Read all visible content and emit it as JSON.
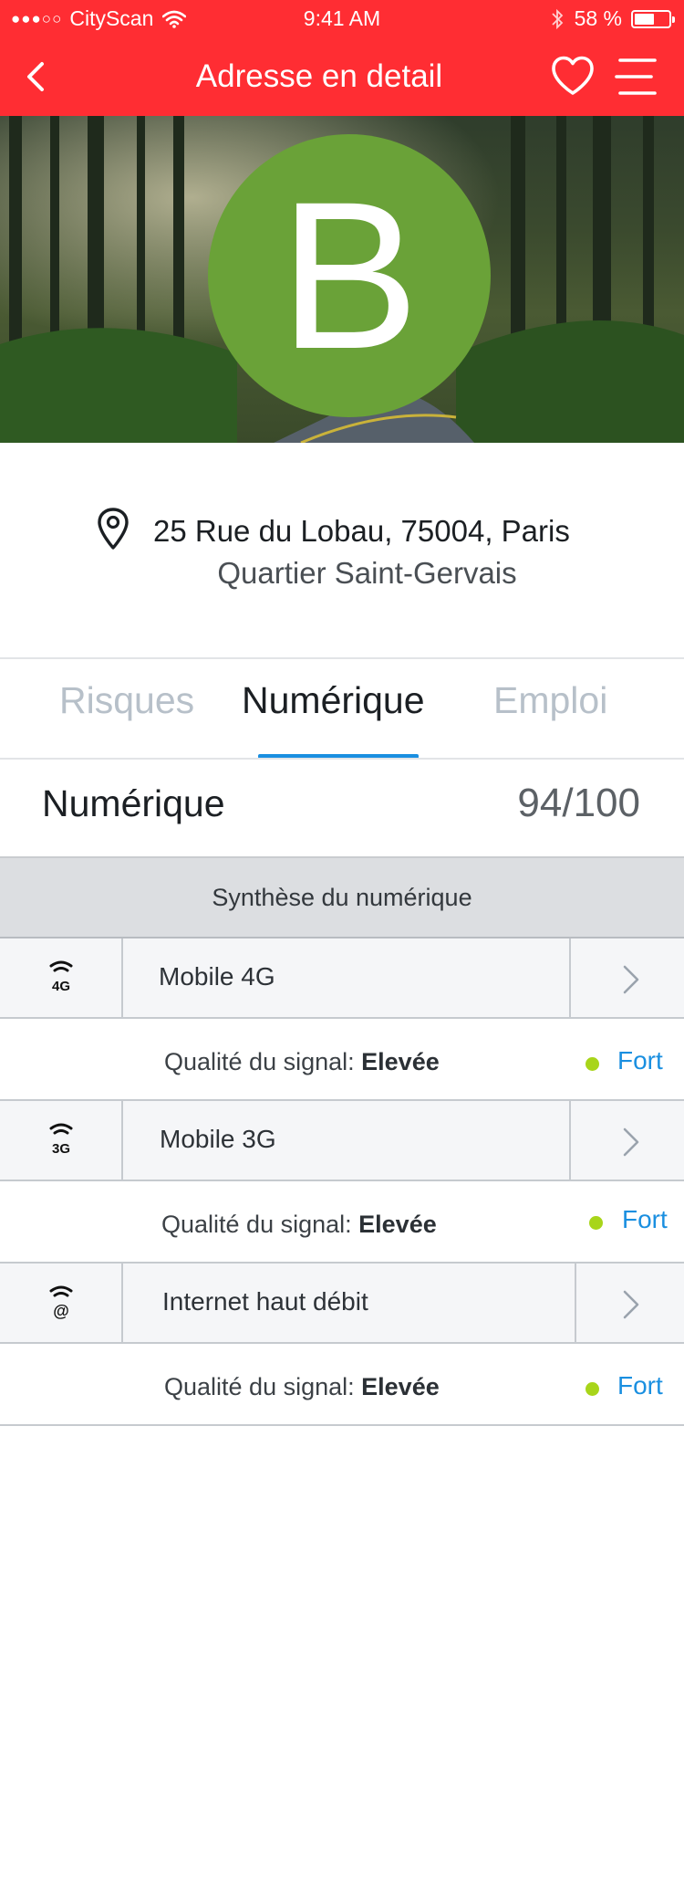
{
  "status_bar": {
    "carrier": "CityScan",
    "time": "9:41 AM",
    "battery": "58 %",
    "battery_level": 0.58
  },
  "nav": {
    "title": "Adresse en detail"
  },
  "hero": {
    "grade": "B"
  },
  "address": {
    "street": "25 Rue du Lobau, 75004, Paris",
    "district": "Quartier Saint-Gervais"
  },
  "tabs": [
    {
      "label": "Risques"
    },
    {
      "label": "Numérique"
    },
    {
      "label": "Emploi"
    }
  ],
  "section": {
    "title": "Numérique",
    "score": "94/100",
    "summary_header": "Synthèse du numérique"
  },
  "items": [
    {
      "icon": "4g-signal-icon",
      "label": "Mobile 4G",
      "quality_prefix": "Qualité du signal:",
      "quality_value": "Elevée",
      "level": "Fort"
    },
    {
      "icon": "3g-signal-icon",
      "label": "Mobile 3G",
      "quality_prefix": "Qualité du signal:",
      "quality_value": "Elevée",
      "level": "Fort"
    },
    {
      "icon": "broadband-signal-icon",
      "label": "Internet haut débit",
      "quality_prefix": "Qualité du signal:",
      "quality_value": "Elevée",
      "level": "Fort"
    }
  ],
  "colors": {
    "header": "#ff2d33",
    "grade": "#6aa238",
    "accent": "#1a8fe0",
    "level_dot": "#a8d51a"
  }
}
